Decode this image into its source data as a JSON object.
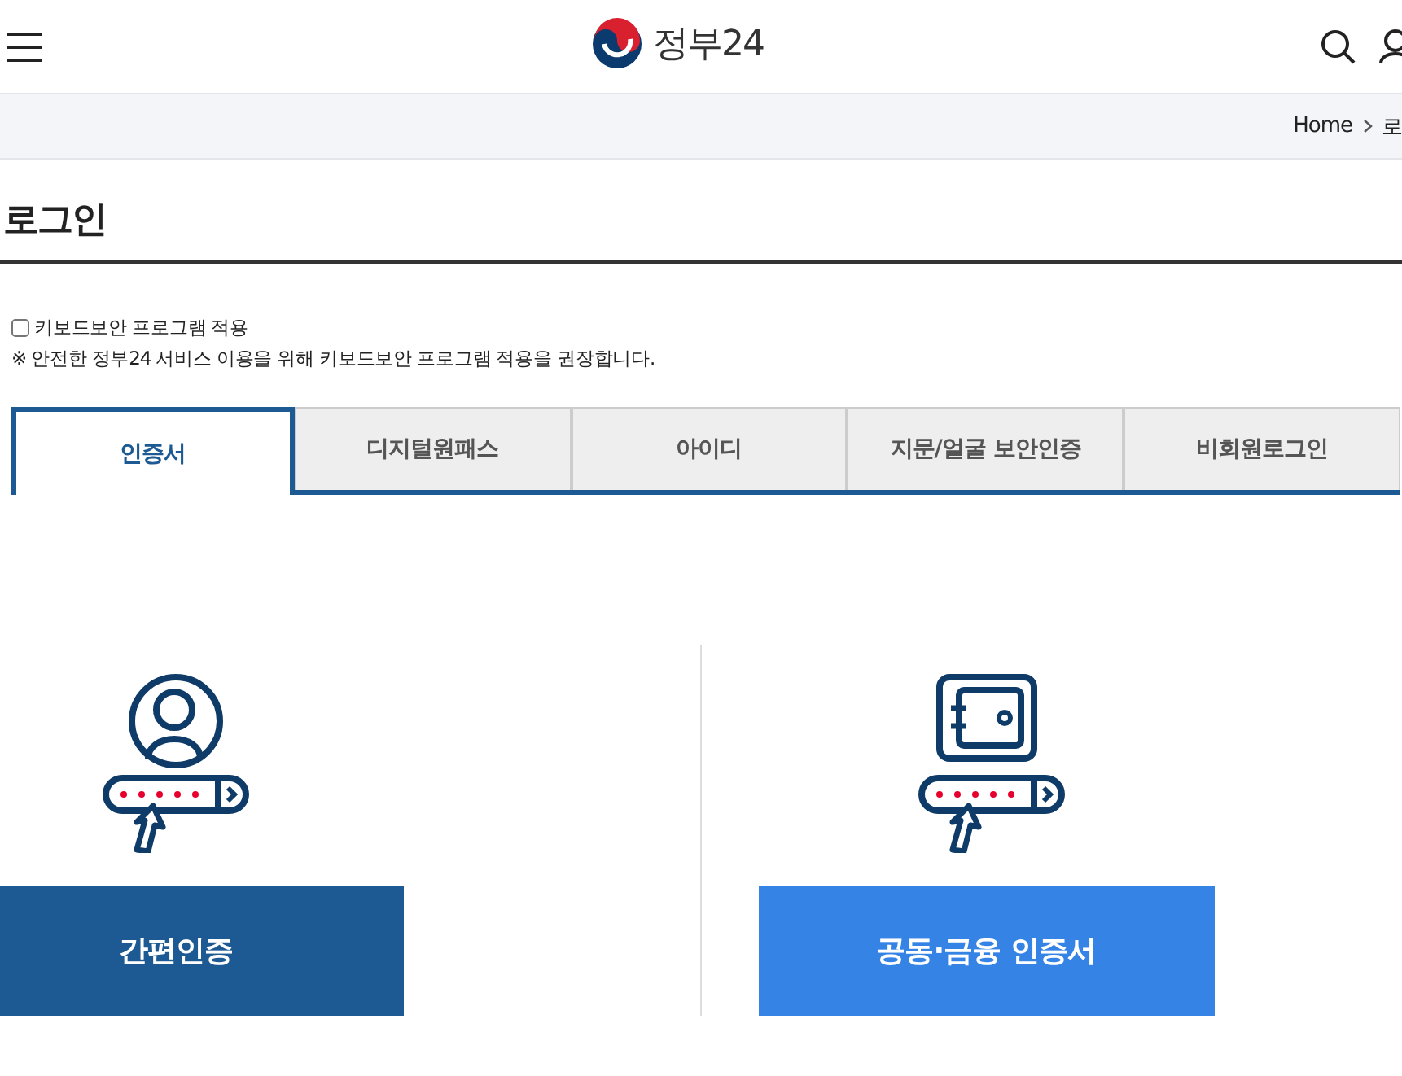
{
  "header": {
    "logo_text": "정부24"
  },
  "breadcrumb": [
    "Home",
    "로"
  ],
  "page_title": "로그인",
  "keyboard_security": {
    "label": "키보드보안 프로그램 적용",
    "checked": false,
    "note": "※ 안전한 정부24 서비스 이용을 위해 키보드보안 프로그램 적용을 권장합니다."
  },
  "tabs": [
    {
      "label": "인증서",
      "selected": true
    },
    {
      "label": "디지털원패스",
      "selected": false
    },
    {
      "label": "아이디",
      "selected": false
    },
    {
      "label": "지문/얼굴 보안인증",
      "selected": false
    },
    {
      "label": "비회원로그인",
      "selected": false
    }
  ],
  "options": [
    {
      "kind": "simple",
      "button": "간편인증"
    },
    {
      "kind": "certificate",
      "button": "공동·금융 인증서"
    }
  ]
}
